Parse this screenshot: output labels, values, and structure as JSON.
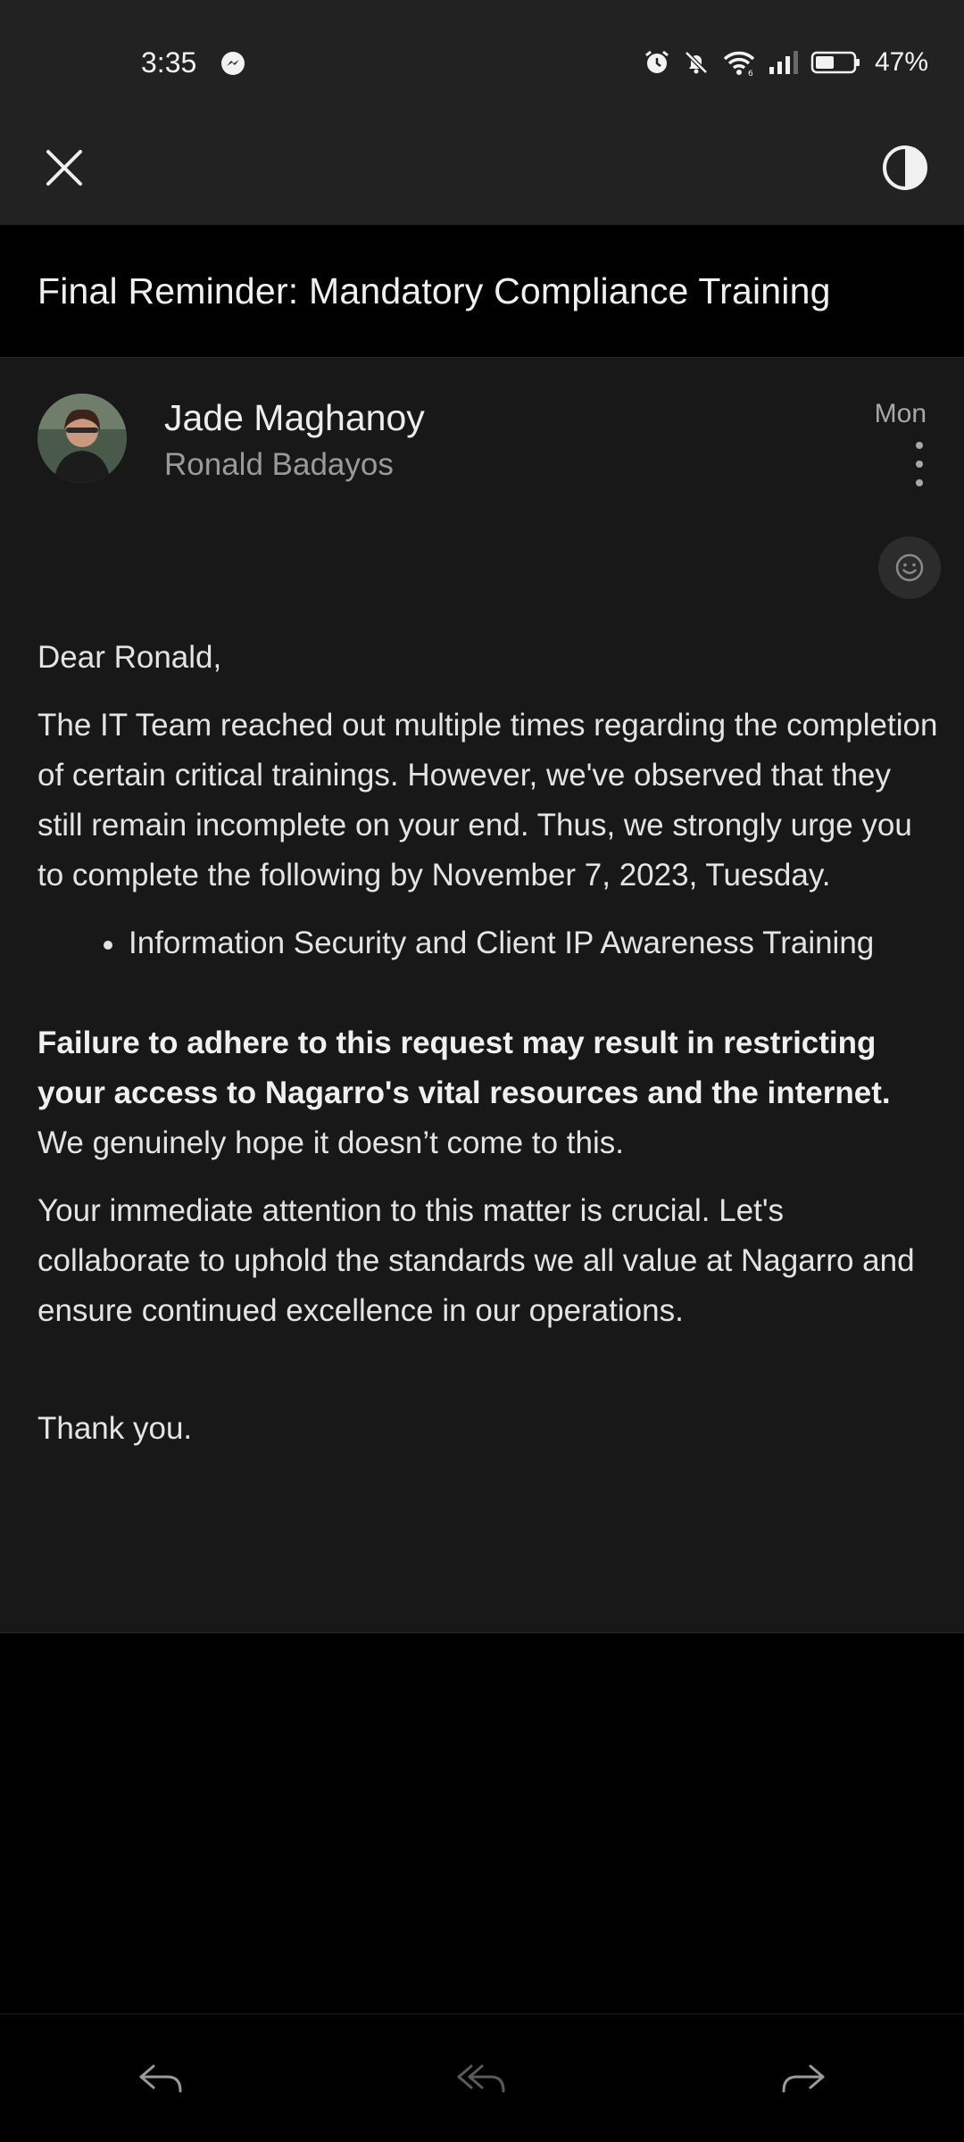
{
  "status_bar": {
    "time": "3:35",
    "battery": "47%",
    "icons": [
      "messenger-icon",
      "alarm-icon",
      "bell-off-icon",
      "wifi-icon",
      "signal-icon",
      "battery-icon"
    ]
  },
  "toolbar": {
    "close_icon": "close-icon",
    "theme_icon": "contrast-icon"
  },
  "email": {
    "subject": "Final Reminder: Mandatory Compliance Training",
    "sender": "Jade Maghanoy",
    "recipient": "Ronald Badayos",
    "date": "Mon",
    "body": {
      "greeting": "Dear Ronald,",
      "paragraph1": "The IT Team reached out multiple times regarding the completion of certain critical trainings. However, we've observed that they still remain incomplete on your end. Thus, we strongly urge you to complete the following by November 7, 2023, Tuesday.",
      "bullets": [
        "Information Security and Client IP Awareness Training"
      ],
      "warning_bold": "Failure to adhere to this request may result in restricting your access to Nagarro's vital resources and the internet.",
      "warning_rest": " We genuinely hope it doesn’t come to this.",
      "paragraph3": "Your immediate attention to this matter is crucial. Let's collaborate to uphold the standards we all value at Nagarro and ensure continued excellence in our operations.",
      "closing": "Thank you."
    }
  },
  "bottom_actions": [
    "reply-icon",
    "reply-all-icon",
    "forward-icon"
  ],
  "colors": {
    "header_bg": "#222222",
    "mail_bg": "#181818",
    "page_bg": "#000000"
  }
}
